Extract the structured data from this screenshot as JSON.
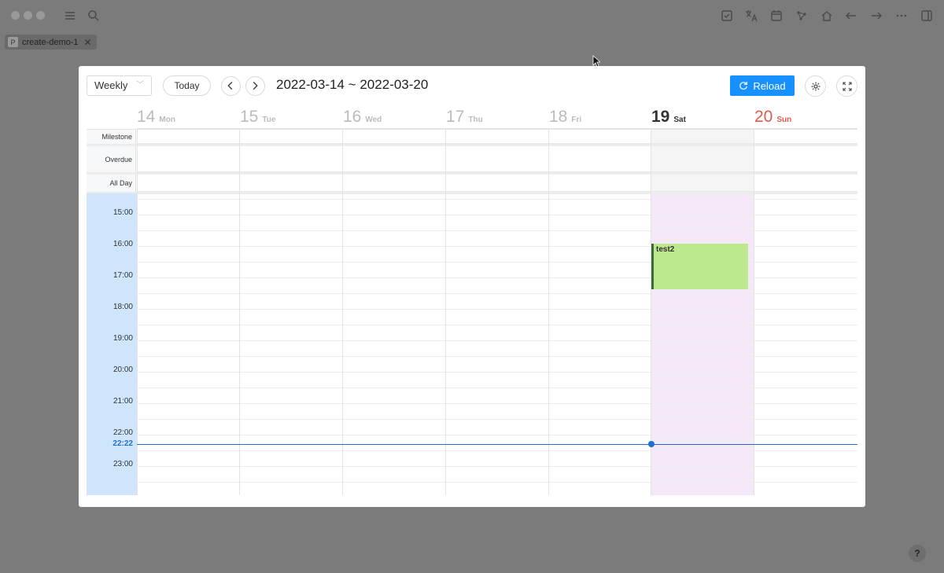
{
  "app": {
    "tab_label": "create-demo-1",
    "tab_badge": "P",
    "help_label": "?"
  },
  "toolbar": {
    "view_select_value": "Weekly",
    "today_label": "Today",
    "prev_label": "<",
    "next_label": ">",
    "range_title": "2022-03-14 ~ 2022-03-20",
    "reload_label": "Reload"
  },
  "days": [
    {
      "num": "14",
      "name": "Mon"
    },
    {
      "num": "15",
      "name": "Tue"
    },
    {
      "num": "16",
      "name": "Wed"
    },
    {
      "num": "17",
      "name": "Thu"
    },
    {
      "num": "18",
      "name": "Fri"
    },
    {
      "num": "19",
      "name": "Sat"
    },
    {
      "num": "20",
      "name": "Sun"
    }
  ],
  "panels": {
    "milestone": "Milestone",
    "overdue": "Overdue",
    "allday": "All Day"
  },
  "hours": [
    "15:00",
    "16:00",
    "17:00",
    "18:00",
    "19:00",
    "20:00",
    "21:00",
    "22:00",
    "23:00"
  ],
  "now_time": "22:22",
  "events": [
    {
      "title": "test2",
      "day": "19",
      "start": "16:00",
      "end": "17:30"
    }
  ],
  "colors": {
    "accent": "#1890ff",
    "today_column": "#f5e8f8",
    "sunday": "#e25b4d",
    "event_fill": "#bde98e",
    "now_line": "#1f6fd1"
  }
}
